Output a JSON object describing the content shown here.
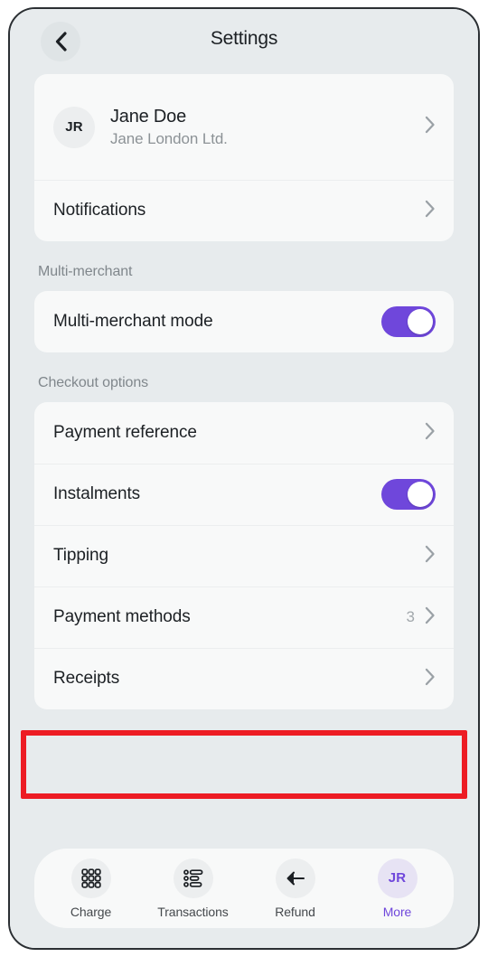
{
  "header": {
    "title": "Settings",
    "back_icon": "chevron-left-icon"
  },
  "profile": {
    "initials": "JR",
    "name": "Jane Doe",
    "company": "Jane London Ltd."
  },
  "account_section": {
    "notifications_label": "Notifications"
  },
  "multi_merchant_section": {
    "section_label": "Multi-merchant",
    "mode_label": "Multi-merchant mode",
    "mode_enabled": true
  },
  "checkout_section": {
    "section_label": "Checkout options",
    "rows": [
      {
        "label": "Payment reference",
        "type": "link",
        "value": ""
      },
      {
        "label": "Instalments",
        "type": "toggle",
        "enabled": true
      },
      {
        "label": "Tipping",
        "type": "link",
        "value": ""
      },
      {
        "label": "Payment methods",
        "type": "link",
        "value": "3"
      },
      {
        "label": "Receipts",
        "type": "link",
        "value": ""
      }
    ]
  },
  "tabbar": {
    "tabs": [
      {
        "label": "Charge",
        "icon": "keypad-grid-icon",
        "active": false
      },
      {
        "label": "Transactions",
        "icon": "list-lines-icon",
        "active": false
      },
      {
        "label": "Refund",
        "icon": "arrow-left-icon",
        "active": false
      },
      {
        "label": "More",
        "icon": "avatar-initials-icon",
        "initials": "JR",
        "active": true
      }
    ]
  },
  "colors": {
    "accent_purple": "#6F47DB",
    "screen_background": "#E7EBED",
    "card_background": "#F8F9F9",
    "annotation_red": "#ED1C24"
  }
}
